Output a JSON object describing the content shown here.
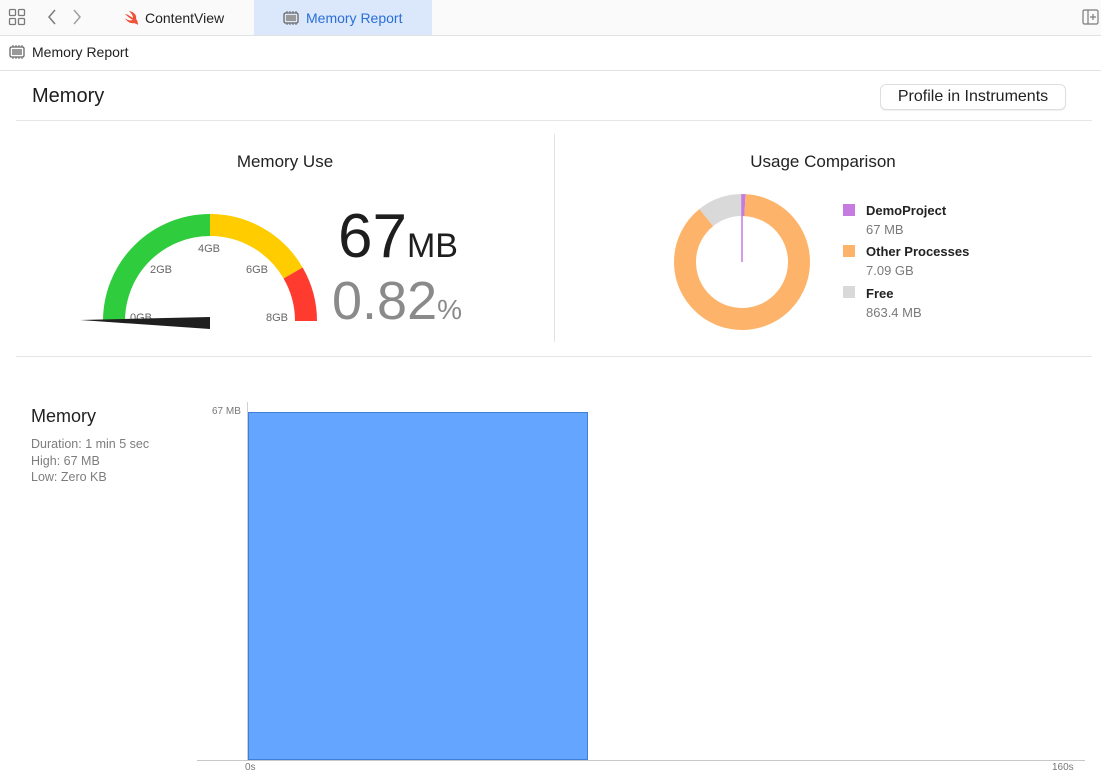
{
  "tabs": [
    {
      "label": "ContentView",
      "icon": "swift-icon",
      "active": false
    },
    {
      "label": "Memory Report",
      "icon": "chip-icon",
      "active": true
    }
  ],
  "breadcrumb": {
    "label": "Memory Report"
  },
  "header": {
    "title": "Memory",
    "profile_button": "Profile in Instruments"
  },
  "memory_use": {
    "title": "Memory Use",
    "value": "67",
    "unit": "MB",
    "percent": "0.82",
    "percent_sign": "%",
    "gauge_labels": [
      "0GB",
      "2GB",
      "4GB",
      "6GB",
      "8GB"
    ],
    "gauge_colors": {
      "green": "#2fcc3d",
      "yellow": "#ffcc00",
      "red": "#ff3b30"
    }
  },
  "usage_comparison": {
    "title": "Usage Comparison",
    "legend": [
      {
        "name": "DemoProject",
        "value": "67 MB",
        "color": "#c57be0"
      },
      {
        "name": "Other Processes",
        "value": "7.09 GB",
        "color": "#fdb46a"
      },
      {
        "name": "Free",
        "value": "863.4 MB",
        "color": "#d9d9d9"
      }
    ]
  },
  "memory_graph": {
    "title": "Memory",
    "duration": "Duration: 1 min 5 sec",
    "high": "High: 67 MB",
    "low": "Low: Zero KB",
    "y_label": "67 MB",
    "x_start": "0s",
    "x_end": "160s",
    "bar_color": "#64a5ff",
    "bar_end_seconds": 65,
    "axis_max_seconds": 160
  },
  "chart_data": [
    {
      "type": "pie",
      "title": "Usage Comparison",
      "categories": [
        "DemoProject",
        "Other Processes",
        "Free"
      ],
      "values": [
        0.067,
        7.09,
        0.8634
      ],
      "unit": "GB"
    },
    {
      "type": "area",
      "title": "Memory",
      "x": [
        0,
        65
      ],
      "values": [
        67,
        67
      ],
      "ylabel": "67 MB",
      "xlim": [
        0,
        160
      ]
    }
  ]
}
